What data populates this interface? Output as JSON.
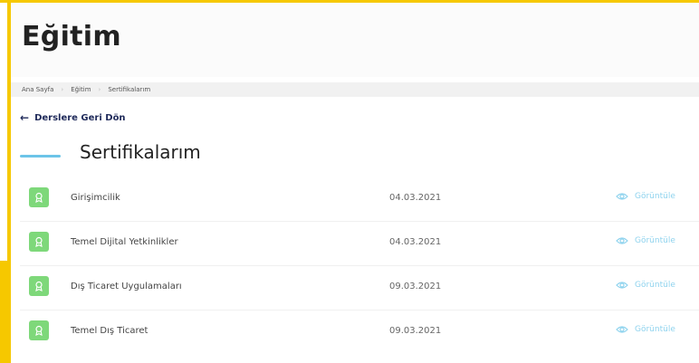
{
  "header": {
    "title": "Eğitim"
  },
  "breadcrumb": [
    "Ana Sayfa",
    "Eğitim",
    "Sertifikalarım"
  ],
  "back_link": {
    "label": "Derslere Geri Dön"
  },
  "section": {
    "title": "Sertifikalarım"
  },
  "certificates": [
    {
      "name": "Girişimcilik",
      "date": "04.03.2021",
      "action": "Görüntüle"
    },
    {
      "name": "Temel Dijital Yetkinlikler",
      "date": "04.03.2021",
      "action": "Görüntüle"
    },
    {
      "name": "Dış Ticaret Uygulamaları",
      "date": "09.03.2021",
      "action": "Görüntüle"
    },
    {
      "name": "Temel Dış Ticaret",
      "date": "09.03.2021",
      "action": "Görüntüle"
    }
  ],
  "colors": {
    "frame": "#f6c800",
    "badge": "#7ed87a",
    "accent": "#6cc4e8",
    "link": "#1f2a5a"
  },
  "icons": {
    "certificate": "award-icon",
    "view": "eye-icon",
    "back": "arrow-left-icon"
  }
}
